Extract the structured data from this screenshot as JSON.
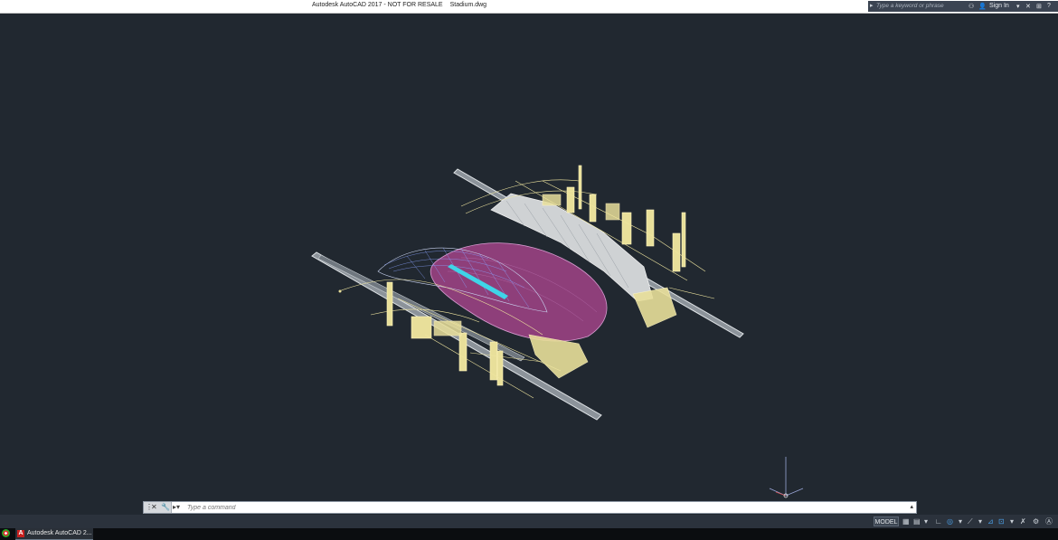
{
  "window": {
    "title": "Autodesk AutoCAD 2017 - NOT FOR RESALE",
    "filename": "Stadium.dwg"
  },
  "search": {
    "placeholder": "Type a keyword or phrase",
    "icon": "search-icon"
  },
  "account": {
    "signin_label": "Sign In"
  },
  "command_line": {
    "placeholder": "Type a command",
    "buttons": [
      "close-icon",
      "wrench-icon",
      "prompt-icon"
    ]
  },
  "status_bar": {
    "model_label": "MODEL",
    "icons": [
      "grid-icon",
      "snap-icon",
      "ortho-icon",
      "polar-icon",
      "osnap-icon",
      "lineweight-icon",
      "annotation-icon",
      "workspace-icon"
    ]
  },
  "taskbar": {
    "app_label": "Autodesk AutoCAD 2..."
  },
  "colors": {
    "viewport_bg": "#212830",
    "field": "#8e3f7a",
    "structure": "#e8df9a",
    "roof": "#c8c8c8",
    "accent": "#4aa0e8"
  }
}
